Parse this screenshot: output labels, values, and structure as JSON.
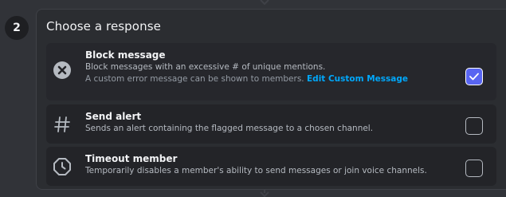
{
  "step": {
    "number": "2"
  },
  "panel": {
    "title": "Choose a response"
  },
  "options": [
    {
      "name": "Block message",
      "description": "Block messages with an excessive # of unique mentions.",
      "sub_description": "A custom error message can be shown to members.",
      "link": "Edit Custom Message",
      "icon": "x-circle-icon",
      "checked": true
    },
    {
      "name": "Send alert",
      "description": "Sends an alert containing the flagged message to a chosen channel.",
      "icon": "hashtag-icon",
      "checked": false
    },
    {
      "name": "Timeout member",
      "description": "Temporarily disables a member's ability to send messages or join voice channels.",
      "icon": "clock-octagon-icon",
      "checked": false
    }
  ],
  "colors": {
    "background": "#313338",
    "panel": "#2b2d31",
    "accent": "#5865f2",
    "link": "#00a8fc"
  }
}
